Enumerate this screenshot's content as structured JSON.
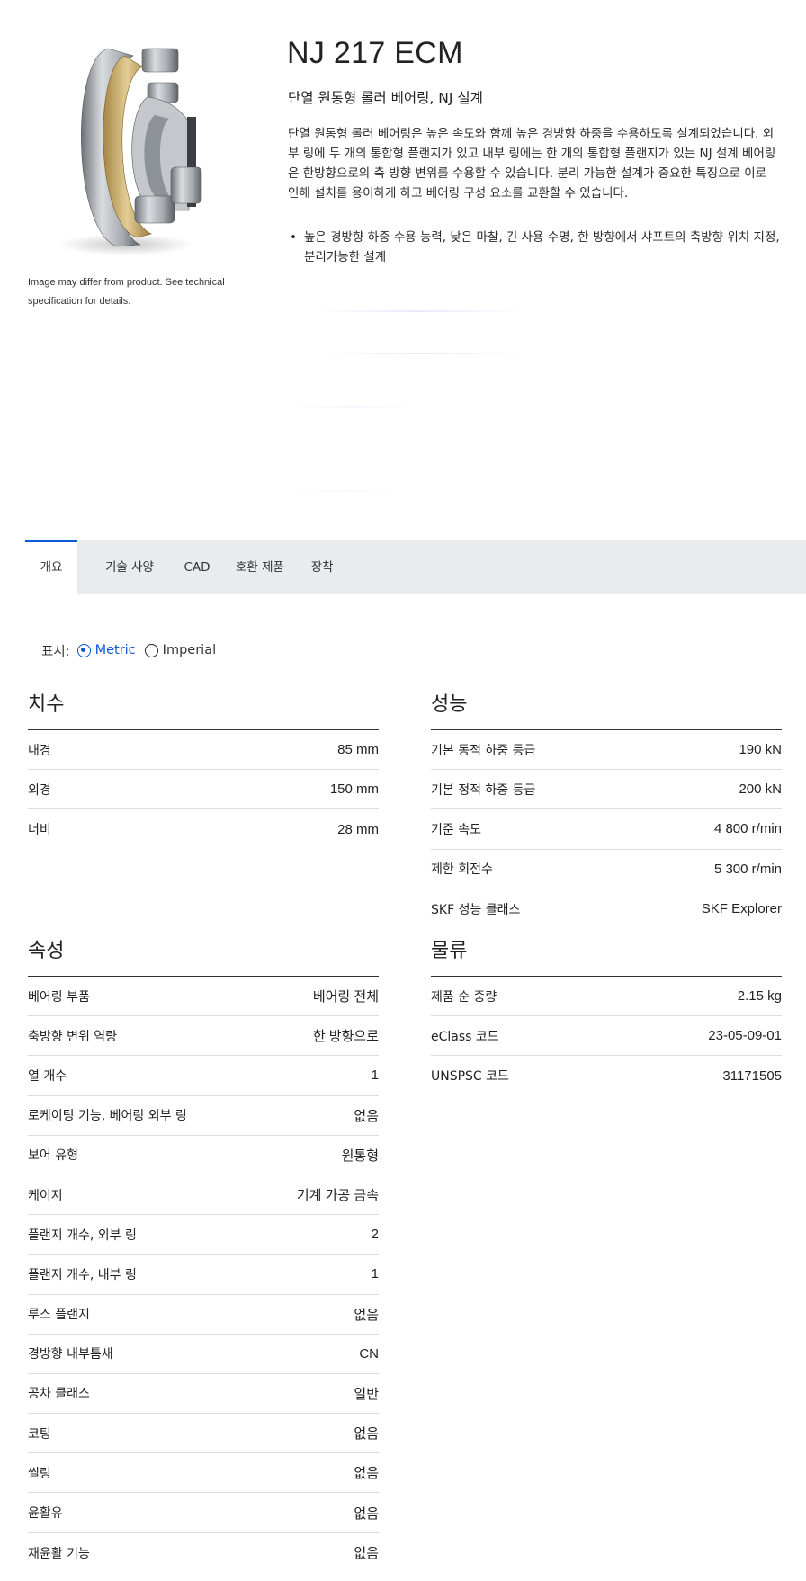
{
  "product": {
    "title": "NJ 217 ECM",
    "subtitle": "단열 원통형 롤러 베어링, NJ 설계",
    "description": "단열 원통형 롤러 베어링은 높은 속도와 함께 높은 경방향 하중을 수용하도록 설계되었습니다. 외부 링에 두 개의 통합형 플랜지가 있고 내부 링에는 한 개의 통합형 플랜지가 있는 NJ 설계 베어링은 한방향으로의 축 방향 변위를 수용할 수 있습니다. 분리 가능한 설계가 중요한 특징으로 이로 인해 설치를 용이하게 하고 베어링 구성 요소를 교환할 수 있습니다.",
    "features": [
      "높은 경방향 하중 수용 능력, 낮은 마찰, 긴 사용 수명, 한 방향에서 샤프트의 축방향 위치 지정, 분리가능한 설계"
    ],
    "image_caption": "Image may differ from product. See technical specification for details."
  },
  "tabs": [
    {
      "label": "개요",
      "active": true
    },
    {
      "label": "기술 사양",
      "active": false
    },
    {
      "label": "CAD",
      "active": false
    },
    {
      "label": "호환 제품",
      "active": false
    },
    {
      "label": "장착",
      "active": false
    }
  ],
  "units": {
    "label": "표시:",
    "options": [
      {
        "label": "Metric",
        "checked": true
      },
      {
        "label": "Imperial",
        "checked": false
      }
    ]
  },
  "sections": {
    "dimensions": {
      "title": "치수",
      "rows": [
        {
          "label": "내경",
          "value": "85 mm"
        },
        {
          "label": "외경",
          "value": "150 mm"
        },
        {
          "label": "너비",
          "value": "28 mm"
        }
      ]
    },
    "performance": {
      "title": "성능",
      "rows": [
        {
          "label": "기본 동적 하중 등급",
          "value": "190 kN"
        },
        {
          "label": "기본 정적 하중 등급",
          "value": "200 kN"
        },
        {
          "label": "기준 속도",
          "value": "4 800 r/min"
        },
        {
          "label": "제한 회전수",
          "value": "5 300 r/min"
        },
        {
          "label": "SKF 성능 클래스",
          "value": "SKF Explorer"
        }
      ]
    },
    "properties": {
      "title": "속성",
      "rows": [
        {
          "label": "베어링 부품",
          "value": "베어링 전체"
        },
        {
          "label": "축방향 변위 역량",
          "value": "한 방향으로"
        },
        {
          "label": "열 개수",
          "value": "1"
        },
        {
          "label": "로케이팅 기능, 베어링 외부 링",
          "value": "없음"
        },
        {
          "label": "보어 유형",
          "value": "원통형"
        },
        {
          "label": "케이지",
          "value": "기계 가공 금속"
        },
        {
          "label": "플랜지 개수, 외부 링",
          "value": "2"
        },
        {
          "label": "플랜지 개수, 내부 링",
          "value": "1"
        },
        {
          "label": "루스 플랜지",
          "value": "없음"
        },
        {
          "label": "경방향 내부틈새",
          "value": "CN"
        },
        {
          "label": "공차 클래스",
          "value": "일반"
        },
        {
          "label": "코팅",
          "value": "없음"
        },
        {
          "label": "씰링",
          "value": "없음"
        },
        {
          "label": "윤활유",
          "value": "없음"
        },
        {
          "label": "재윤활 기능",
          "value": "없음"
        }
      ]
    },
    "logistics": {
      "title": "물류",
      "rows": [
        {
          "label": "제품 순 중량",
          "value": "2.15 kg"
        },
        {
          "label": "eClass 코드",
          "value": "23-05-09-01"
        },
        {
          "label": "UNSPSC 코드",
          "value": "31171505"
        }
      ]
    }
  },
  "colors": {
    "accent": "#0f58d6",
    "tabbar_bg": "#e9ecee",
    "cage_brass": "#c9ab6c",
    "steel": "#a9adb3"
  }
}
